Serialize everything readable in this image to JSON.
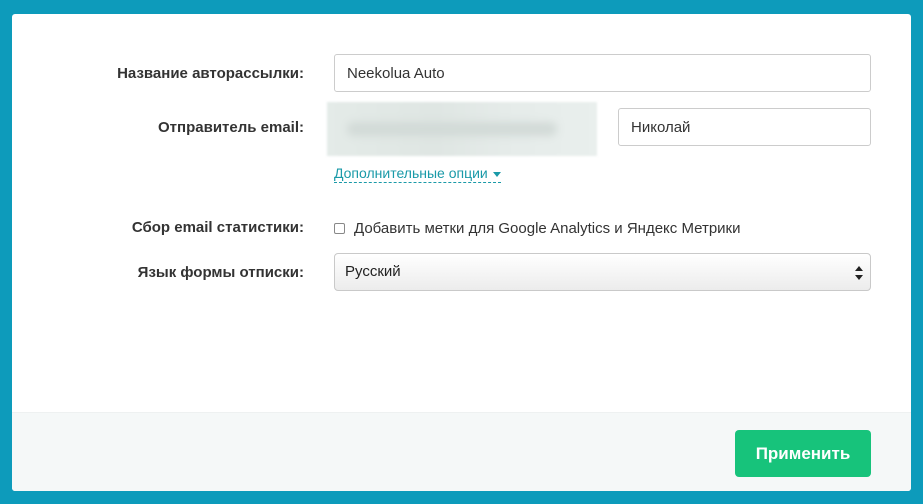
{
  "form": {
    "campaign_name": {
      "label": "Название авторассылки:",
      "value": "Neekolua Auto"
    },
    "sender": {
      "label": "Отправитель email:",
      "name_value": "Николай"
    },
    "extra_options": {
      "label": "Дополнительные опции"
    },
    "stats": {
      "label": "Сбор email статистики:",
      "checkbox_label": "Добавить метки для Google Analytics и Яндекс Метрики",
      "checked": false
    },
    "unsubscribe_language": {
      "label": "Язык формы отписки:",
      "selected": "Русский"
    }
  },
  "footer": {
    "apply_label": "Применить"
  },
  "colors": {
    "frame": "#0d9bbb",
    "link": "#1a9aa8",
    "primary_button": "#17c37b"
  }
}
